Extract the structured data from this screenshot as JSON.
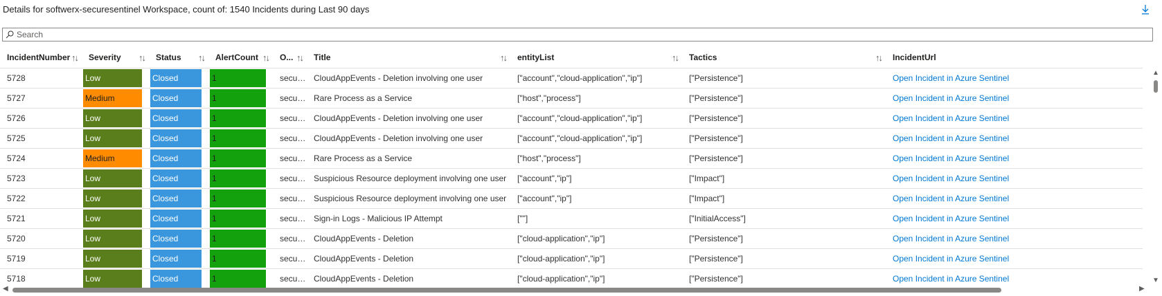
{
  "header": {
    "title": "Details for softwerx-securesentinel Workspace, count of: 1540 Incidents during Last 90 days",
    "download_icon": "download-icon"
  },
  "search": {
    "placeholder": "Search",
    "value": ""
  },
  "table": {
    "columns": [
      {
        "label": "IncidentNumber",
        "key": "number"
      },
      {
        "label": "Severity",
        "key": "severity"
      },
      {
        "label": "Status",
        "key": "status"
      },
      {
        "label": "AlertCount",
        "key": "alerts"
      },
      {
        "label": "O...",
        "key": "owner"
      },
      {
        "label": "Title",
        "key": "title"
      },
      {
        "label": "entityList",
        "key": "entities"
      },
      {
        "label": "Tactics",
        "key": "tactics"
      },
      {
        "label": "IncidentUrl",
        "key": "url"
      }
    ],
    "sort_icon": "↑↓",
    "rows": [
      {
        "number": "5728",
        "severity": "Low",
        "status": "Closed",
        "alerts": "1",
        "owner": "secure...",
        "title": "CloudAppEvents - Deletion involving one user",
        "entities": "[\"account\",\"cloud-application\",\"ip\"]",
        "tactics": "[\"Persistence\"]",
        "url": "Open Incident in Azure Sentinel"
      },
      {
        "number": "5727",
        "severity": "Medium",
        "status": "Closed",
        "alerts": "1",
        "owner": "secure...",
        "title": "Rare Process as a Service",
        "entities": "[\"host\",\"process\"]",
        "tactics": "[\"Persistence\"]",
        "url": "Open Incident in Azure Sentinel"
      },
      {
        "number": "5726",
        "severity": "Low",
        "status": "Closed",
        "alerts": "1",
        "owner": "secure...",
        "title": "CloudAppEvents - Deletion involving one user",
        "entities": "[\"account\",\"cloud-application\",\"ip\"]",
        "tactics": "[\"Persistence\"]",
        "url": "Open Incident in Azure Sentinel"
      },
      {
        "number": "5725",
        "severity": "Low",
        "status": "Closed",
        "alerts": "1",
        "owner": "secure...",
        "title": "CloudAppEvents - Deletion involving one user",
        "entities": "[\"account\",\"cloud-application\",\"ip\"]",
        "tactics": "[\"Persistence\"]",
        "url": "Open Incident in Azure Sentinel"
      },
      {
        "number": "5724",
        "severity": "Medium",
        "status": "Closed",
        "alerts": "1",
        "owner": "secure...",
        "title": "Rare Process as a Service",
        "entities": "[\"host\",\"process\"]",
        "tactics": "[\"Persistence\"]",
        "url": "Open Incident in Azure Sentinel"
      },
      {
        "number": "5723",
        "severity": "Low",
        "status": "Closed",
        "alerts": "1",
        "owner": "secure...",
        "title": "Suspicious Resource deployment involving one user",
        "entities": "[\"account\",\"ip\"]",
        "tactics": "[\"Impact\"]",
        "url": "Open Incident in Azure Sentinel"
      },
      {
        "number": "5722",
        "severity": "Low",
        "status": "Closed",
        "alerts": "1",
        "owner": "secure...",
        "title": "Suspicious Resource deployment involving one user",
        "entities": "[\"account\",\"ip\"]",
        "tactics": "[\"Impact\"]",
        "url": "Open Incident in Azure Sentinel"
      },
      {
        "number": "5721",
        "severity": "Low",
        "status": "Closed",
        "alerts": "1",
        "owner": "secure...",
        "title": "Sign-in Logs - Malicious IP Attempt",
        "entities": "[\"\"]",
        "tactics": "[\"InitialAccess\"]",
        "url": "Open Incident in Azure Sentinel"
      },
      {
        "number": "5720",
        "severity": "Low",
        "status": "Closed",
        "alerts": "1",
        "owner": "secure...",
        "title": "CloudAppEvents - Deletion",
        "entities": "[\"cloud-application\",\"ip\"]",
        "tactics": "[\"Persistence\"]",
        "url": "Open Incident in Azure Sentinel"
      },
      {
        "number": "5719",
        "severity": "Low",
        "status": "Closed",
        "alerts": "1",
        "owner": "secure...",
        "title": "CloudAppEvents - Deletion",
        "entities": "[\"cloud-application\",\"ip\"]",
        "tactics": "[\"Persistence\"]",
        "url": "Open Incident in Azure Sentinel"
      },
      {
        "number": "5718",
        "severity": "Low",
        "status": "Closed",
        "alerts": "1",
        "owner": "secure...",
        "title": "CloudAppEvents - Deletion",
        "entities": "[\"cloud-application\",\"ip\"]",
        "tactics": "[\"Persistence\"]",
        "url": "Open Incident in Azure Sentinel"
      }
    ]
  },
  "colors": {
    "severity_low": "#5a7e1c",
    "severity_medium": "#ff8c00",
    "status_closed": "#3a96dd",
    "alert_count": "#13a10e",
    "link": "#0078d4"
  }
}
